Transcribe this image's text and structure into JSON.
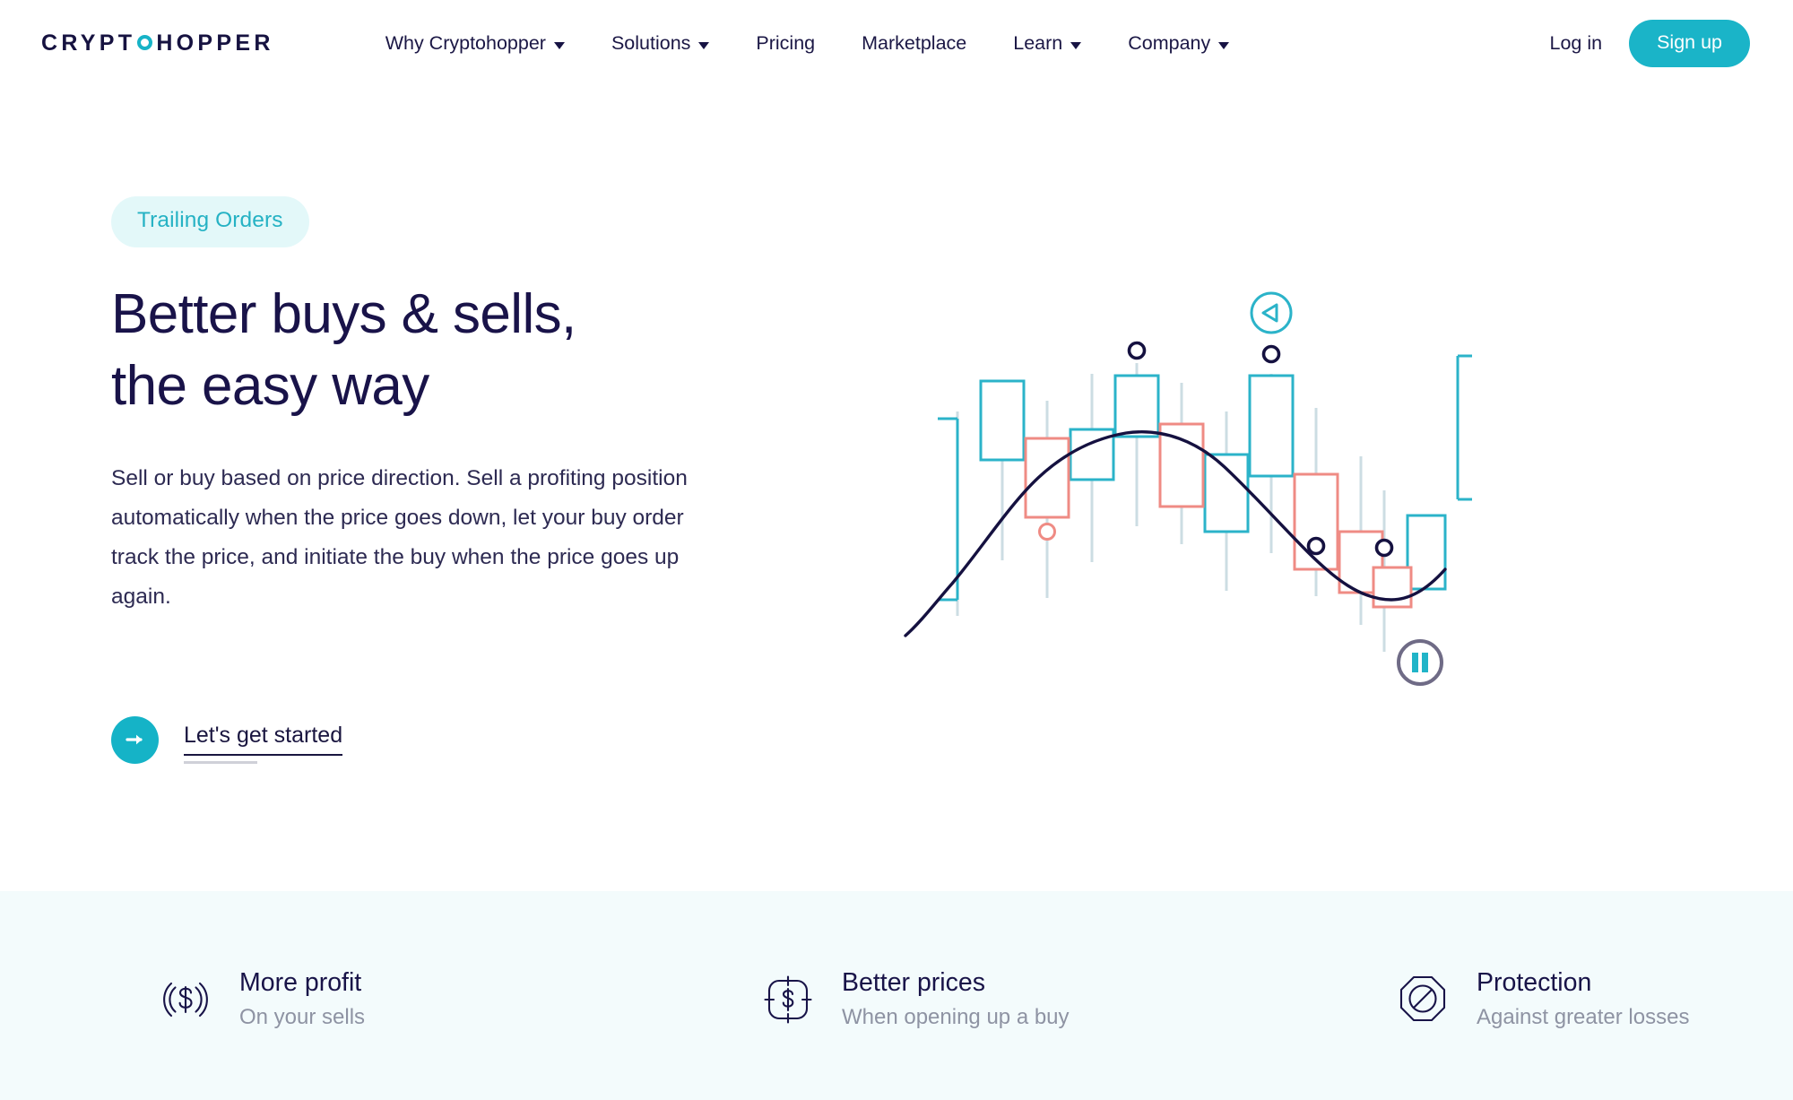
{
  "brand": {
    "name_part1": "CRYPT",
    "name_o": "O",
    "name_part2": "H",
    "name_o2": "O",
    "name_part3": "PPER",
    "accent_color": "#17b3c7"
  },
  "nav": {
    "items": [
      {
        "label": "Why Cryptohopper",
        "has_dropdown": true
      },
      {
        "label": "Solutions",
        "has_dropdown": true
      },
      {
        "label": "Pricing",
        "has_dropdown": false
      },
      {
        "label": "Marketplace",
        "has_dropdown": false
      },
      {
        "label": "Learn",
        "has_dropdown": true
      },
      {
        "label": "Company",
        "has_dropdown": true
      }
    ],
    "login_label": "Log in",
    "signup_label": "Sign up",
    "signup_bg": "#1ab4c8"
  },
  "hero": {
    "badge": "Trailing Orders",
    "badge_bg": "#e3f8f9",
    "badge_color": "#25b2c4",
    "title_line1": "Better buys & sells,",
    "title_line2": "the easy way",
    "description": "Sell or buy based on price direction. Sell a profiting position automatically when the price goes down, let your buy order track the price, and initiate the buy when the price goes up again.",
    "cta_label": "Let's get started",
    "cta_icon": "arrow-right-icon",
    "cta_circle_color": "#15b3c7"
  },
  "chart_data": {
    "type": "candlestick",
    "title": "",
    "bullish_color": "#2bb3c9",
    "bearish_color": "#ef8b84",
    "wick_color": "#ccdde3",
    "trendline_color": "#151140",
    "marker_color": "#151140",
    "axis": {
      "grid": false,
      "ticks": false
    },
    "candles": [
      {
        "index": 0,
        "direction": "bull",
        "open": 26,
        "close": 68,
        "high": 74,
        "low": 16,
        "wide_bracket": true
      },
      {
        "index": 1,
        "direction": "bull",
        "open": 58,
        "close": 80,
        "high": 88,
        "low": 40
      },
      {
        "index": 2,
        "direction": "bear",
        "open": 64,
        "close": 44,
        "high": 72,
        "low": 20,
        "marker": "open-circle-bear"
      },
      {
        "index": 3,
        "direction": "bull",
        "open": 62,
        "close": 74,
        "high": 80,
        "low": 42
      },
      {
        "index": 4,
        "direction": "bull",
        "open": 70,
        "close": 86,
        "high": 96,
        "low": 54,
        "marker": "open-circle-dark"
      },
      {
        "index": 5,
        "direction": "bear",
        "open": 80,
        "close": 58,
        "high": 88,
        "low": 42
      },
      {
        "index": 6,
        "direction": "bull",
        "open": 44,
        "close": 62,
        "high": 72,
        "low": 30
      },
      {
        "index": 7,
        "direction": "bull",
        "open": 48,
        "close": 84,
        "high": 92,
        "low": 36,
        "marker": "open-circle-dark",
        "badge": "play-badge"
      },
      {
        "index": 8,
        "direction": "bear",
        "open": 60,
        "close": 34,
        "high": 70,
        "low": 24
      },
      {
        "index": 9,
        "direction": "bear",
        "open": 38,
        "close": 22,
        "high": 50,
        "low": 14,
        "marker": "open-circle-dark"
      },
      {
        "index": 10,
        "direction": "bear",
        "open": 24,
        "close": 14,
        "high": 34,
        "low": 6
      },
      {
        "index": 11,
        "direction": "bull",
        "open": 8,
        "close": 28,
        "high": 34,
        "low": 2,
        "wide_bracket_right": true
      }
    ],
    "trendline": "arc rising from lower-left, peaking near candle 4-5, then descending to lower-right and curving up at the end"
  },
  "playback": {
    "play_badge_icon": "play-triangle-icon",
    "play_badge_color": "#2bb3c9",
    "pause_icon": "pause-icon",
    "pause_ring_color": "#6f6b86",
    "pause_bar_color": "#21b4c8"
  },
  "features": [
    {
      "icon": "dollar-broadcast-icon",
      "title": "More profit",
      "subtitle": "On your sells"
    },
    {
      "icon": "dollar-crop-frame-icon",
      "title": "Better prices",
      "subtitle": "When opening up a buy"
    },
    {
      "icon": "octagon-block-icon",
      "title": "Protection",
      "subtitle": "Against greater losses"
    }
  ],
  "features_bg": "#f3fbfc"
}
